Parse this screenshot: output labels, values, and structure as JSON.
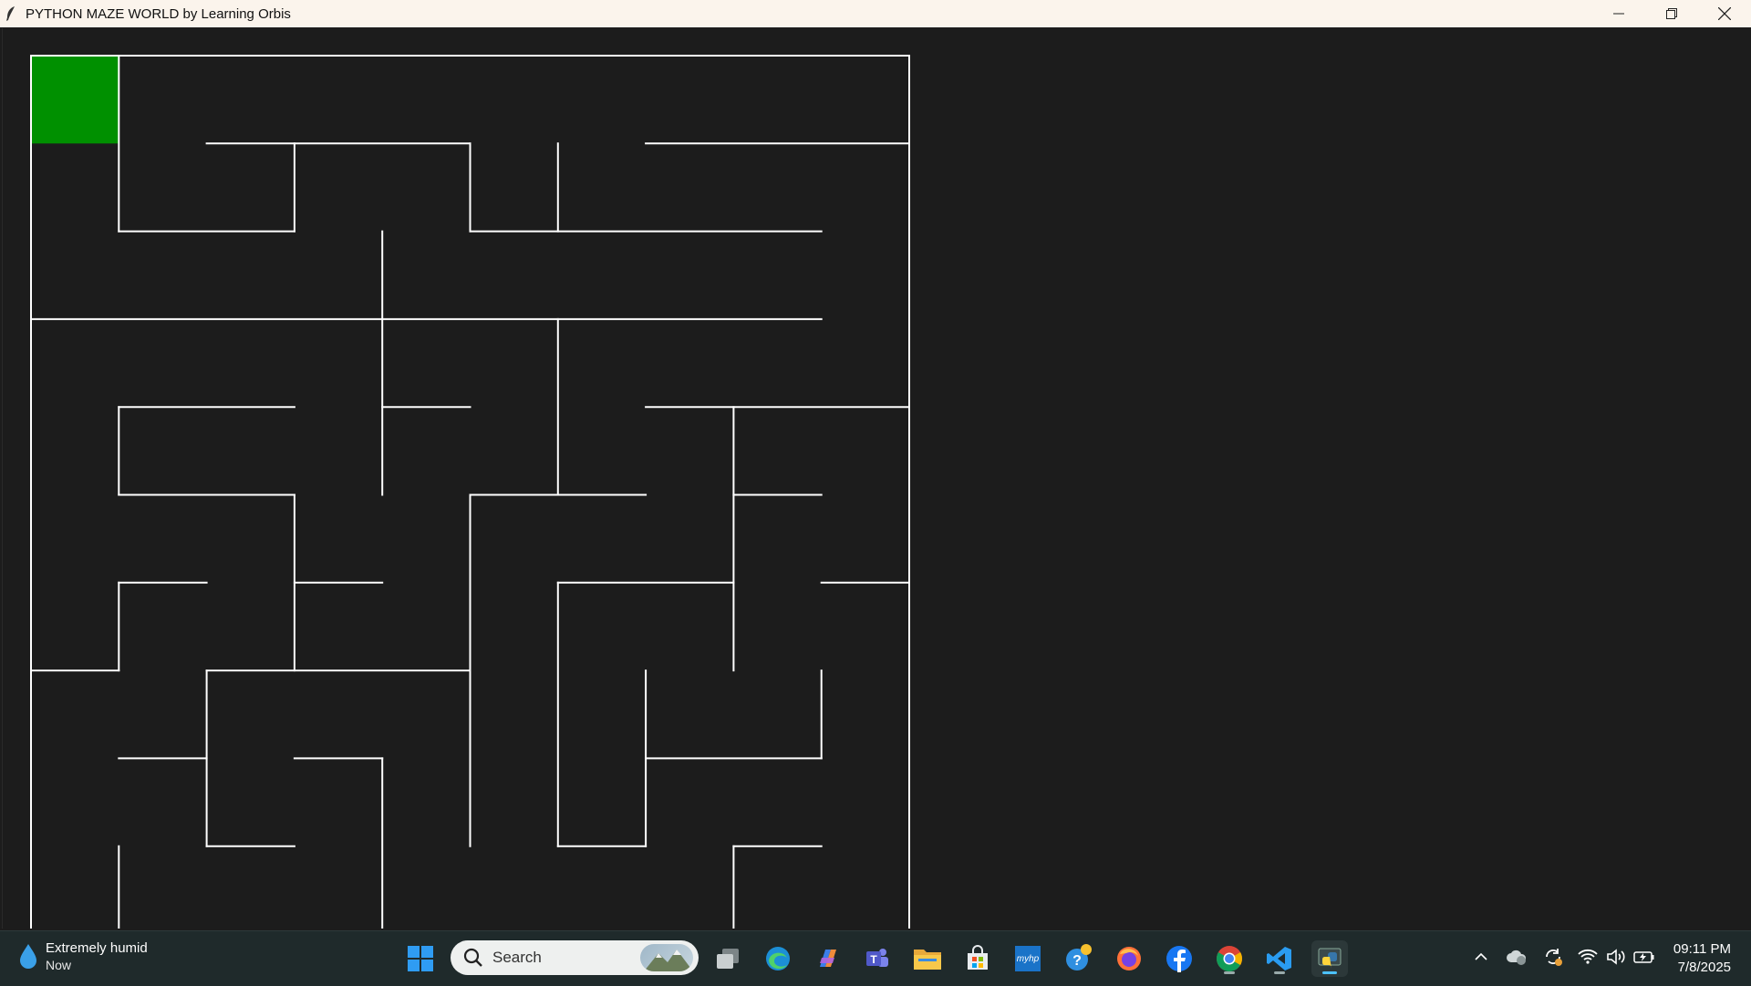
{
  "window": {
    "title": "PYTHON MAZE WORLD by Learning Orbis"
  },
  "maze": {
    "rows": 10,
    "cols": 10,
    "wall_color": "#ffffff",
    "background_color": "#1c1c1c",
    "start_cell": {
      "row": 0,
      "col": 0,
      "color": "#009000"
    }
  },
  "taskbar": {
    "weather": {
      "title": "Extremely humid",
      "subtitle": "Now",
      "icon": "water-drop-icon"
    },
    "search_placeholder": "Search",
    "pinned": [
      {
        "name": "start-button",
        "icon": "windows-logo-icon"
      },
      {
        "name": "task-view-button",
        "icon": "task-view-icon"
      },
      {
        "name": "edge-button",
        "icon": "edge-icon"
      },
      {
        "name": "copilot-button",
        "icon": "copilot-icon"
      },
      {
        "name": "teams-button",
        "icon": "teams-icon"
      },
      {
        "name": "file-explorer-button",
        "icon": "folder-icon"
      },
      {
        "name": "store-button",
        "icon": "store-icon"
      },
      {
        "name": "myhp-button",
        "icon": "myhp-icon"
      },
      {
        "name": "help-button",
        "icon": "help-icon"
      },
      {
        "name": "firefox-button",
        "icon": "firefox-icon"
      },
      {
        "name": "facebook-button",
        "icon": "facebook-icon"
      },
      {
        "name": "chrome-button",
        "icon": "chrome-icon"
      },
      {
        "name": "vscode-button",
        "icon": "vscode-icon"
      },
      {
        "name": "python-button",
        "icon": "python-icon"
      }
    ],
    "myhp_label": "myhp",
    "clock": {
      "time": "09:11 PM",
      "date": "7/8/2025"
    }
  }
}
